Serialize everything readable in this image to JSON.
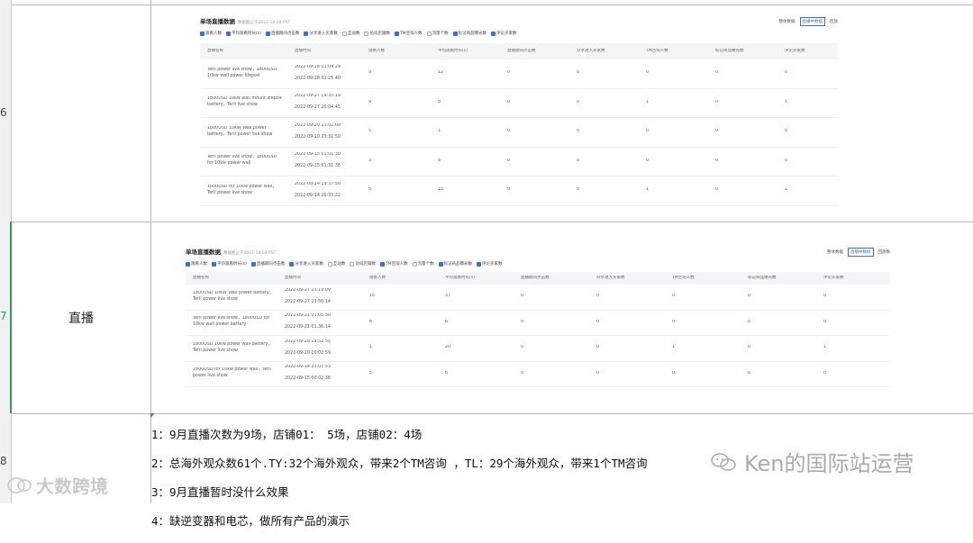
{
  "sheet": {
    "row_numbers": [
      "6",
      "7",
      "8"
    ],
    "category_label": "直播"
  },
  "panel1": {
    "title": "单场直播数据",
    "subtitle": "数据截止于2022-10-04 PST",
    "tabs": [
      "整体数据",
      "直播中数据",
      "回放"
    ],
    "active_tab": 1,
    "filters": [
      {
        "label": "观看人数",
        "checked": true
      },
      {
        "label": "平均观看时长(s)",
        "checked": true
      },
      {
        "label": "直播期间点击数",
        "checked": true
      },
      {
        "label": "分享进入买家数",
        "checked": true
      },
      {
        "label": "互动数",
        "checked": false
      },
      {
        "label": "访问店铺数",
        "checked": false
      },
      {
        "label": "TM咨询人数",
        "checked": true
      },
      {
        "label": "流量个数",
        "checked": false
      },
      {
        "label": "标记商品曝光数",
        "checked": true
      },
      {
        "label": "评论买家数",
        "checked": true
      }
    ],
    "columns": [
      "直播名称",
      "直播时间",
      "观看人数",
      "平均观看时长(s)",
      "直播期间点击数",
      "分享进入买家数",
      "TM咨询人数",
      "标记商品曝光数",
      "评论买家数"
    ],
    "rows": [
      {
        "name": "Terli power live show，1800USD 10kw wall power lifepo4",
        "start": "2022-09-28 01:04:29",
        "end": "2022-09-28 01:25:40",
        "values": [
          "9",
          "12",
          "0",
          "0",
          "0",
          "0",
          "0"
        ]
      },
      {
        "name": "1800USD 10kw wall mount lifepo4 battery，Terli live show",
        "start": "2022-09-27 19:35:19",
        "end": "2022-09-27 20:04:45",
        "values": [
          "9",
          "8",
          "0",
          "0",
          "1",
          "0",
          "1"
        ]
      },
      {
        "name": "1800USD 10KW Wall power battery，Terli power live show",
        "start": "2022-09-20 23:01:00",
        "end": "2022-09-20 23:31:50",
        "values": [
          "5",
          "1",
          "0",
          "0",
          "0",
          "0",
          "0"
        ]
      },
      {
        "name": "Terli power live show，1800USD for 10kw power wall",
        "start": "2022-09-15 01:01:30",
        "end": "2022-09-15 01:31:36",
        "values": [
          "3",
          "8",
          "0",
          "0",
          "0",
          "0",
          "0"
        ]
      },
      {
        "name": "1800USD for 10kw power wall，Terli power live show",
        "start": "2022-09-14 19:37:50",
        "end": "2022-09-14 20:33:22",
        "values": [
          "5",
          "13",
          "0",
          "0",
          "1",
          "0",
          "1"
        ]
      }
    ]
  },
  "panel2": {
    "title": "单场直播数据",
    "subtitle": "数据截止于2022-10-04 PST",
    "tabs": [
      "整体数据",
      "直播中数据",
      "回放数"
    ],
    "active_tab": 1,
    "filters": [
      {
        "label": "观看人数",
        "checked": true
      },
      {
        "label": "平均观看时长(s)",
        "checked": true
      },
      {
        "label": "直播期间点击数",
        "checked": true
      },
      {
        "label": "分享进入买家数",
        "checked": true
      },
      {
        "label": "互动数",
        "checked": false
      },
      {
        "label": "访问店铺数",
        "checked": false
      },
      {
        "label": "TM咨询人数",
        "checked": true
      },
      {
        "label": "流量个数",
        "checked": false
      },
      {
        "label": "标记商品曝光数",
        "checked": true
      },
      {
        "label": "评论买家数",
        "checked": true
      }
    ],
    "columns": [
      "直播名称",
      "直播时间",
      "观看人数",
      "平均观看时长(s)",
      "直播期间点击数",
      "分享进入买家数",
      "TM咨询人数",
      "标记商品曝光数",
      "评论买家数"
    ],
    "rows": [
      {
        "name": "1800USD 10KW Wall power battery，Terli power live show",
        "start": "2022-09-27 23:19:09",
        "end": "2022-09-27 23:50:14",
        "values": [
          "15",
          "37",
          "0",
          "0",
          "0",
          "0",
          "0"
        ]
      },
      {
        "name": "Terli power live show，1800USD for 10kw wall power battery",
        "start": "2022-09-21 01:05:30",
        "end": "2022-09-21 01:36:14",
        "values": [
          "6",
          "6",
          "0",
          "0",
          "0",
          "0",
          "0"
        ]
      },
      {
        "name": "1800USD 10kw power wall battery，Terli power live show",
        "start": "2022-09-20 19:52:55",
        "end": "2022-09-20 20:02:59",
        "values": [
          "1",
          "20",
          "0",
          "0",
          "1",
          "0",
          "1"
        ]
      },
      {
        "name": "1800USD for 10kw power wall，Terli power live show",
        "start": "2022-09-14 23:07:53",
        "end": "2022-09-15 00:02:38",
        "values": [
          "5",
          "6",
          "0",
          "0",
          "0",
          "0",
          "0"
        ]
      }
    ]
  },
  "notes": [
    "1：9月直播次数为9场，店铺01： 5场，店铺02：4场",
    "2：总海外观众数61个.TY:32个海外观众，带来2个TM咨询 ，TL：29个海外观众，带来1个TM咨询",
    "3：9月直播暂时没什么效果",
    "4：缺逆变器和电芯，做所有产品的演示"
  ],
  "watermarks": {
    "right": "Ken的国际站运营",
    "left": "大数跨境"
  }
}
